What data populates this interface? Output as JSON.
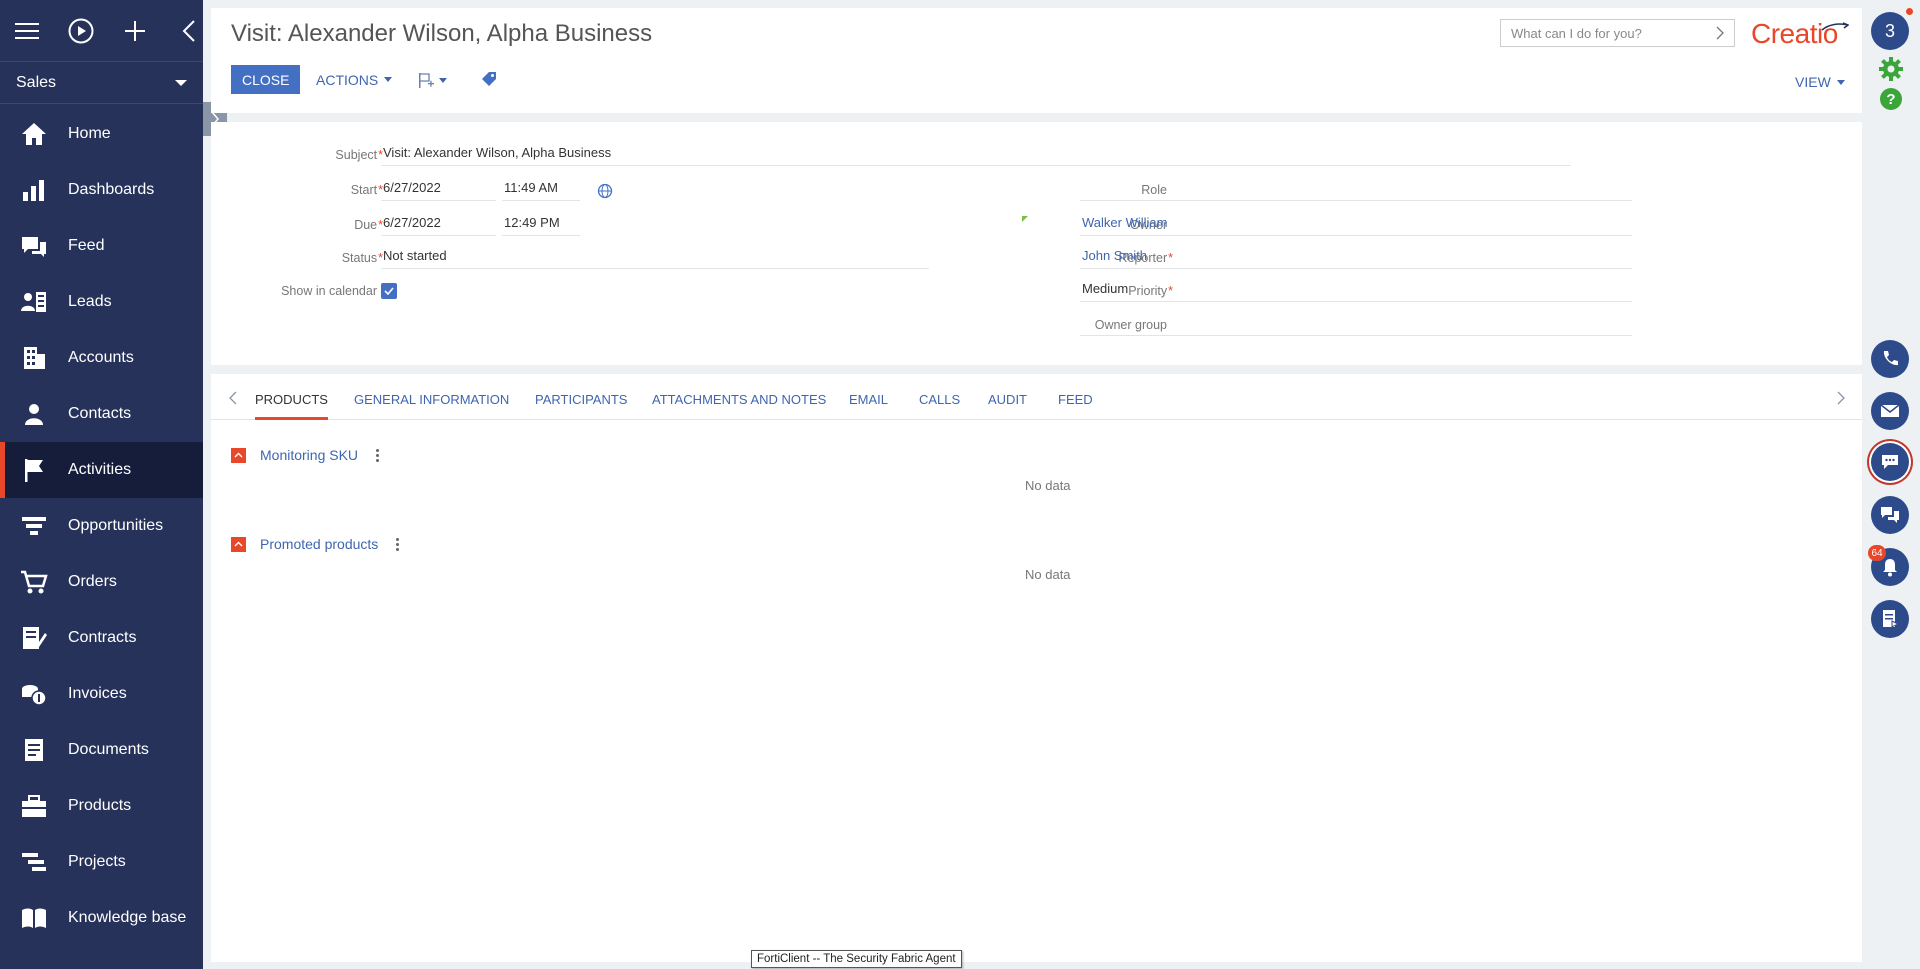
{
  "sidebar": {
    "workspace": "Sales",
    "items": [
      {
        "label": "Home",
        "icon": "home-icon"
      },
      {
        "label": "Dashboards",
        "icon": "dashboards-icon"
      },
      {
        "label": "Feed",
        "icon": "feed-icon"
      },
      {
        "label": "Leads",
        "icon": "leads-icon"
      },
      {
        "label": "Accounts",
        "icon": "accounts-icon"
      },
      {
        "label": "Contacts",
        "icon": "contacts-icon"
      },
      {
        "label": "Activities",
        "icon": "activities-flag-icon",
        "active": true
      },
      {
        "label": "Opportunities",
        "icon": "opportunities-funnel-icon"
      },
      {
        "label": "Orders",
        "icon": "orders-cart-icon"
      },
      {
        "label": "Contracts",
        "icon": "contracts-icon"
      },
      {
        "label": "Invoices",
        "icon": "invoices-icon"
      },
      {
        "label": "Documents",
        "icon": "documents-icon"
      },
      {
        "label": "Products",
        "icon": "products-icon"
      },
      {
        "label": "Projects",
        "icon": "projects-icon"
      },
      {
        "label": "Knowledge base",
        "icon": "knowledge-base-icon"
      }
    ]
  },
  "header": {
    "title": "Visit: Alexander Wilson, Alpha Business",
    "close_label": "CLOSE",
    "actions_label": "ACTIONS",
    "view_label": "VIEW",
    "search_placeholder": "What can I do for you?",
    "logo_text": "Creatio"
  },
  "form": {
    "subject_label": "Subject",
    "subject_value": "Visit: Alexander Wilson, Alpha Business",
    "start_label": "Start",
    "start_date": "6/27/2022",
    "start_time": "11:49 AM",
    "due_label": "Due",
    "due_date": "6/27/2022",
    "due_time": "12:49 PM",
    "status_label": "Status",
    "status_value": "Not started",
    "show_in_calendar_label": "Show in calendar",
    "show_in_calendar_checked": true,
    "role_label": "Role",
    "role_value": "",
    "owner_label": "Owner",
    "owner_value": "Walker William",
    "reporter_label": "Reporter",
    "reporter_value": "John Smith",
    "priority_label": "Priority",
    "priority_value": "Medium",
    "owner_group_label": "Owner group",
    "owner_group_value": ""
  },
  "tabs": [
    {
      "label": "PRODUCTS",
      "active": true
    },
    {
      "label": "GENERAL INFORMATION"
    },
    {
      "label": "PARTICIPANTS"
    },
    {
      "label": "ATTACHMENTS AND NOTES"
    },
    {
      "label": "EMAIL"
    },
    {
      "label": "CALLS"
    },
    {
      "label": "AUDIT"
    },
    {
      "label": "FEED"
    }
  ],
  "details": [
    {
      "title": "Monitoring SKU",
      "empty_text": "No data"
    },
    {
      "title": "Promoted products",
      "empty_text": "No data"
    }
  ],
  "rail": {
    "user_badge": "3",
    "notifications_count": "64"
  },
  "tooltip": "FortiClient -- The Security Fabric Agent",
  "colors": {
    "sidebar_bg": "#26325a",
    "accent_red": "#e8472a",
    "primary_blue": "#4470c4",
    "link_blue": "#3f65b0",
    "settings_green": "#3aa63a"
  }
}
